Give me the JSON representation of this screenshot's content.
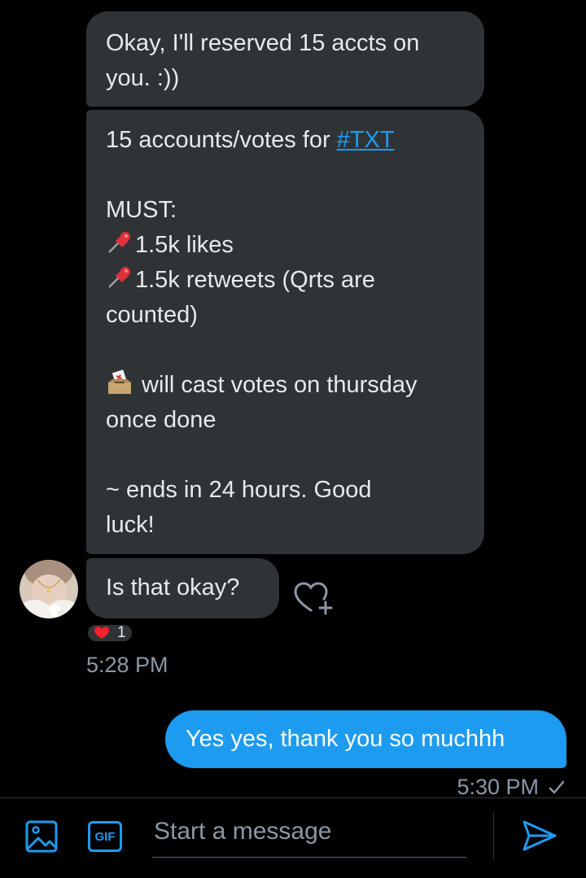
{
  "messages": {
    "m1": {
      "lines": [
        "Okay, I'll reserved 15 accts on",
        "you. :))"
      ]
    },
    "m2": {
      "line1_prefix": "15 accounts/votes for ",
      "hashtag": "#TXT",
      "must": "MUST:",
      "likes": "1.5k likes",
      "retweets": "1.5k retweets (Qrts are",
      "retweets_cont": "counted)",
      "votes": " will cast votes on thursday",
      "votes_cont": "once done",
      "ends": "~ ends in 24 hours. Good",
      "ends_cont": "luck!"
    },
    "m3": {
      "text": "Is that okay?"
    },
    "reaction_count": "1",
    "received_time": "5:28 PM",
    "sent": {
      "text": "Yes yes, thank you so muchhh",
      "time": "5:30 PM"
    }
  },
  "composer": {
    "placeholder": "Start a message",
    "gif_label": "GIF"
  },
  "icons": [
    "pushpin-icon",
    "ballot-box-icon",
    "heart-add-icon",
    "heart-icon",
    "image-icon",
    "gif-icon",
    "send-icon",
    "check-icon"
  ],
  "colors": {
    "accent": "#1d9bf0",
    "bubble": "#2f3336",
    "muted": "#8b98a5",
    "background": "#000000"
  }
}
